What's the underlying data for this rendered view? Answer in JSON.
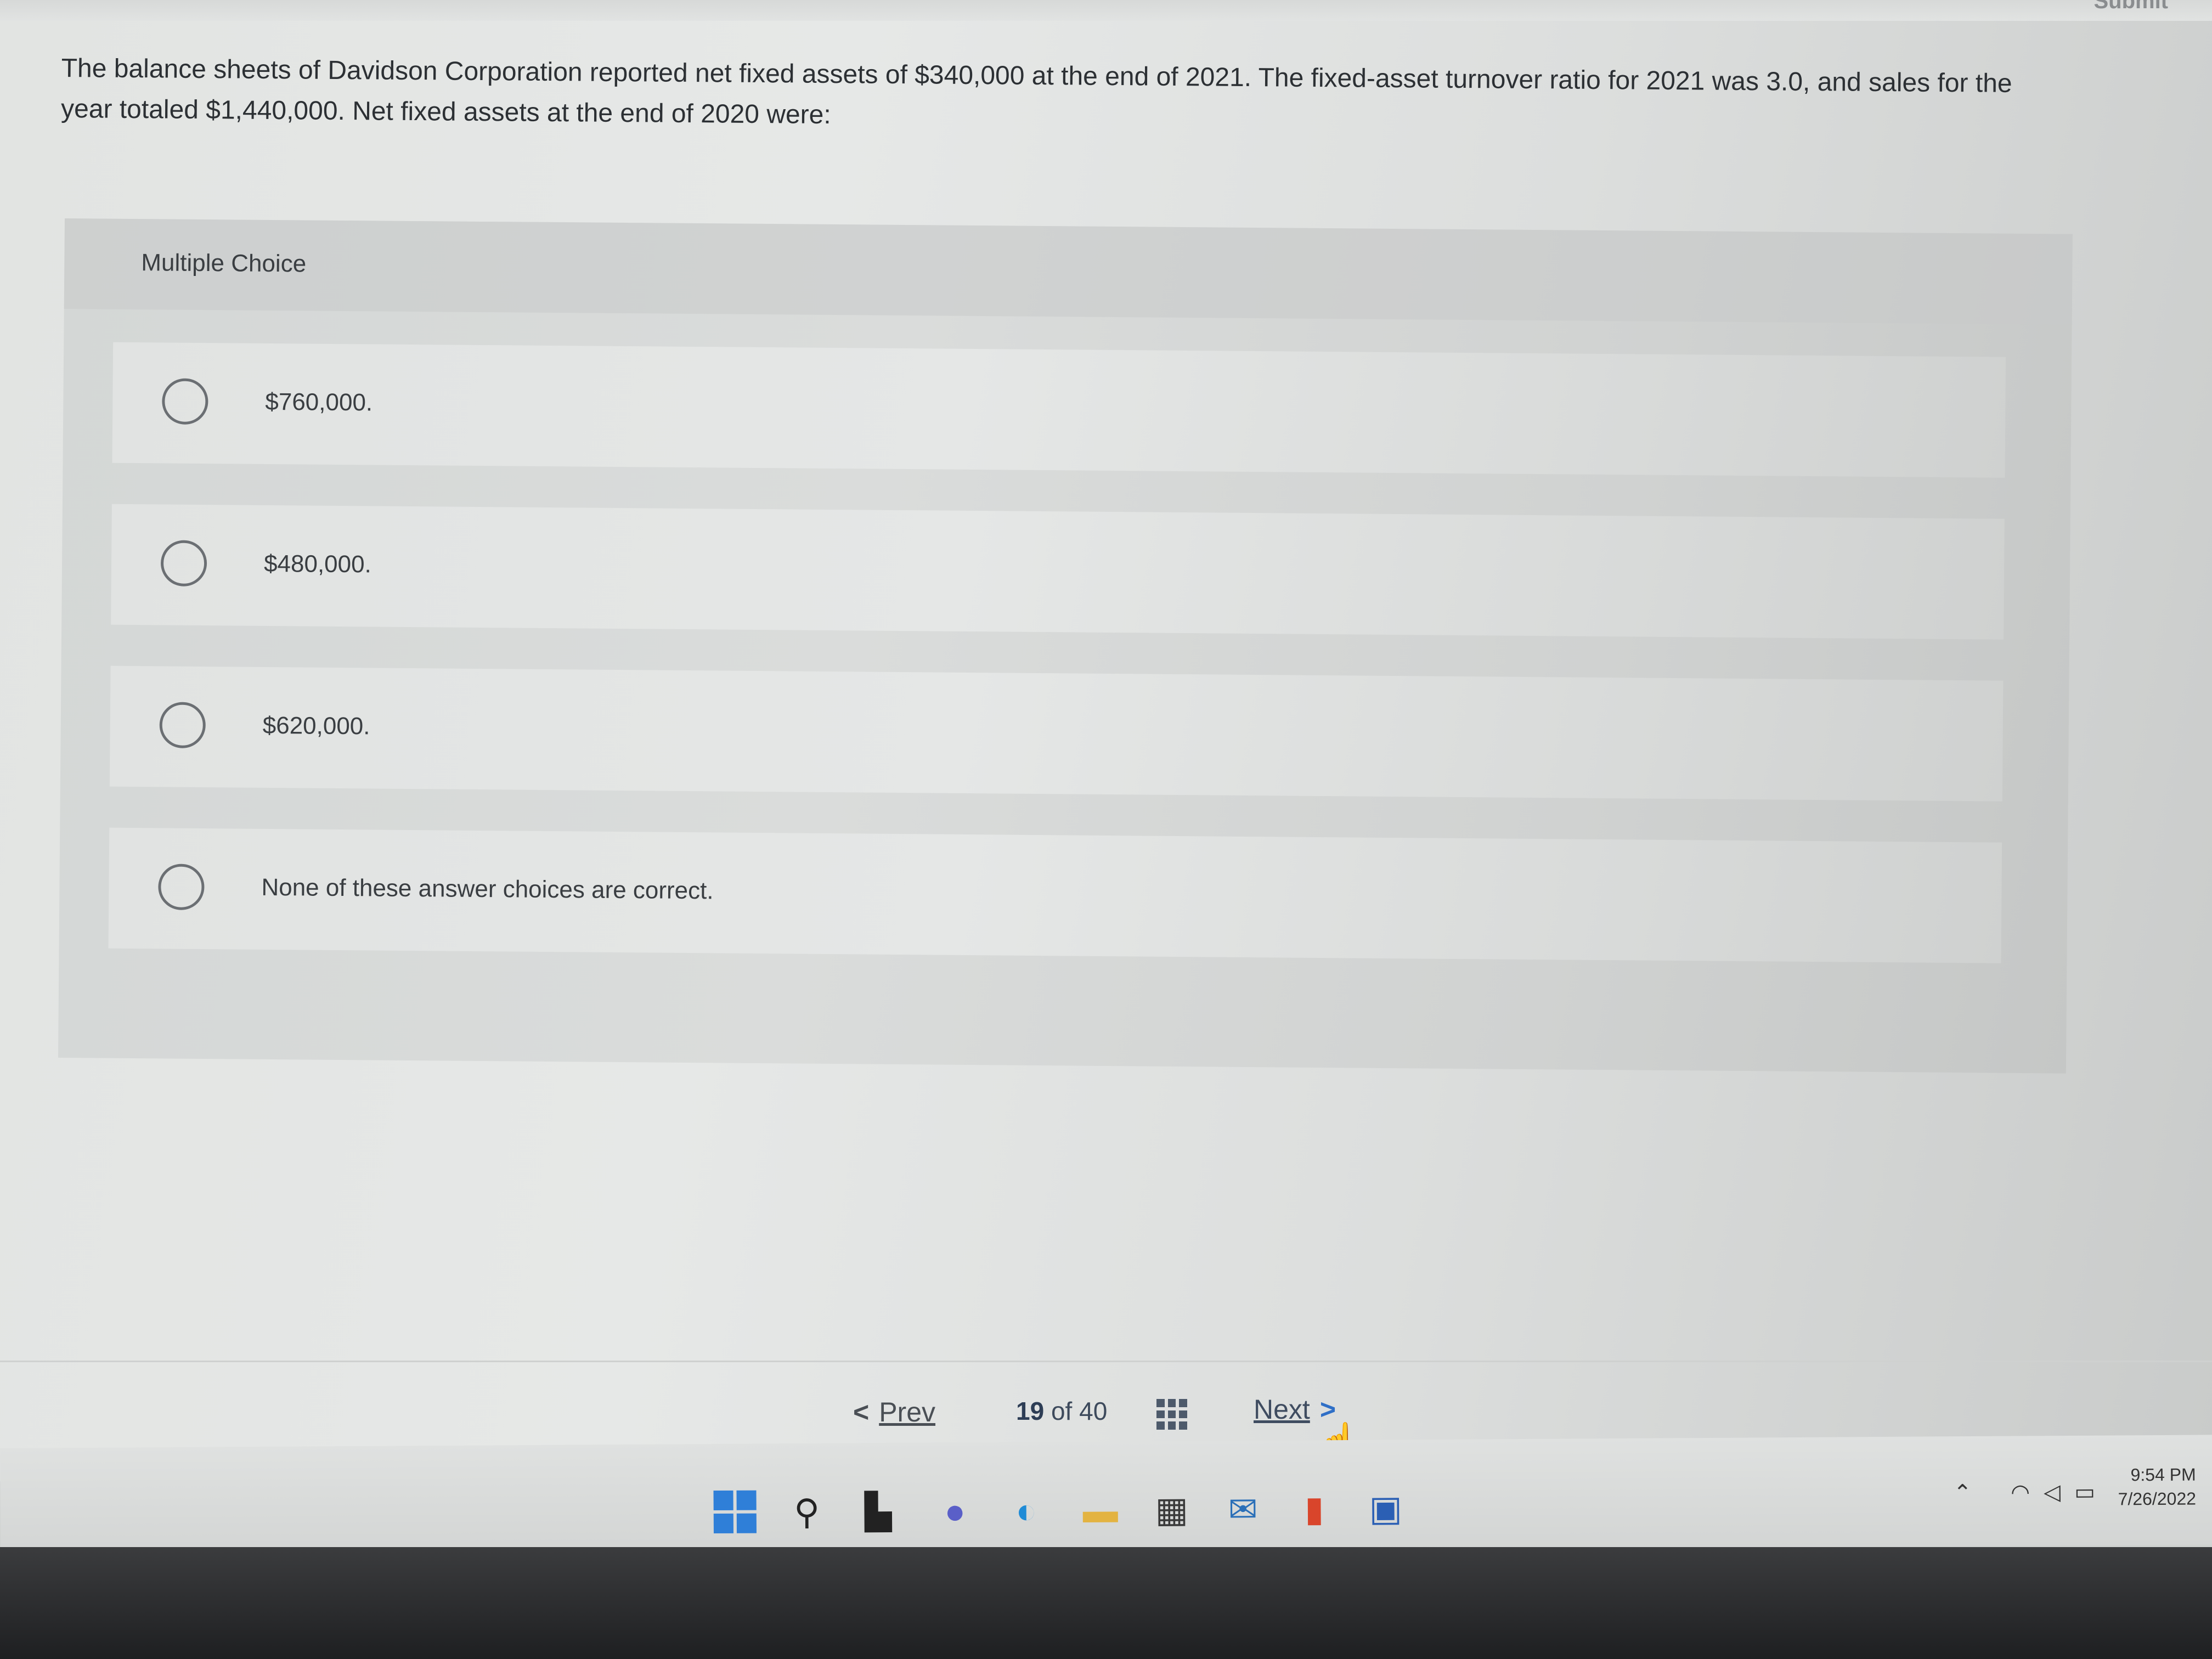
{
  "question": {
    "text": "The balance sheets of Davidson Corporation reported net fixed assets of $340,000 at the end of 2021. The fixed-asset turnover ratio for 2021 was 3.0, and sales for the year totaled $1,440,000. Net fixed assets at the end of 2020 were:"
  },
  "multiple_choice": {
    "label": "Multiple Choice",
    "options": [
      {
        "text": "$760,000."
      },
      {
        "text": "$480,000."
      },
      {
        "text": "$620,000."
      },
      {
        "text": "None of these answer choices are correct."
      }
    ]
  },
  "navigation": {
    "prev_chevron": "<",
    "prev_label": "Prev",
    "current_page": "19",
    "of_label": "of",
    "total_pages": "40",
    "next_label": "Next",
    "next_chevron": ">"
  },
  "header": {
    "submit_label": "Submit"
  },
  "taskbar": {
    "time": "9:54 PM",
    "date": "7/26/2022",
    "accent_color": "#2f7fd8"
  }
}
